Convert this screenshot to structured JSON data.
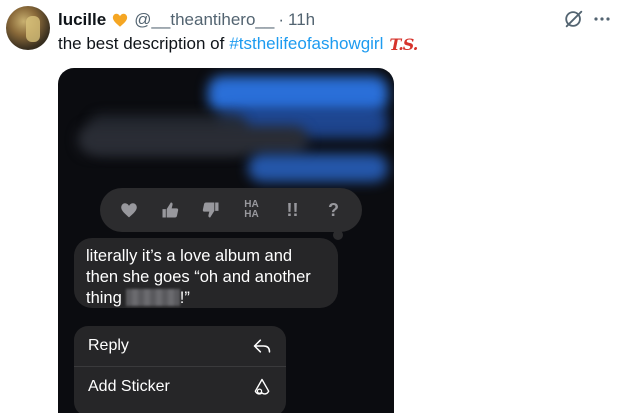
{
  "tweet": {
    "author_name": "lucille",
    "author_handle": "@__theantihero__",
    "separator": "·",
    "time": "11h",
    "text": "the best description of",
    "hashtag": "#tsthelifeofashowgirl",
    "hashtag_emoji": "T.S."
  },
  "icons": {
    "verified": "orange-heart-icon",
    "grok": "grok-icon",
    "more": "more-icon"
  },
  "message": {
    "line1": "literally it’s a love album and",
    "line2": "then she goes “oh and another",
    "line3_start": "thing",
    "line3_end": "!”"
  },
  "reactions": {
    "haha_top": "HA",
    "haha_bottom": "HA",
    "exclaim": "!!",
    "question": "?"
  },
  "menu": {
    "reply_label": "Reply",
    "sticker_label": "Add Sticker"
  },
  "colors": {
    "accent": "#1d9bf0",
    "heart": "#f5a623",
    "ts_emoji": "#d6332c"
  }
}
